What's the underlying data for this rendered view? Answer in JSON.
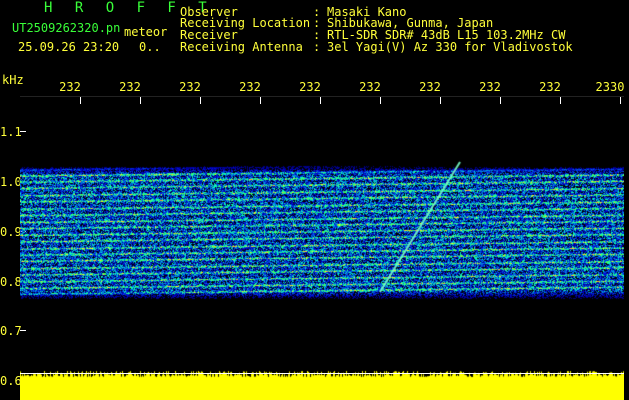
{
  "header": {
    "station": "H R O F F T",
    "filename": "UT2509262320.pn",
    "meteor_word": "meteor",
    "local_time": "25.09.26 23:20",
    "count": "0..",
    "fields": [
      {
        "label": "Observer",
        "sep": ":",
        "value": "Masaki Kano"
      },
      {
        "label": "Receiving Location",
        "sep": ":",
        "value": "Shibukawa, Gunma, Japan"
      },
      {
        "label": "Receiver",
        "sep": ":",
        "value": "RTL-SDR SDR# 43dB L15 103.2MHz CW"
      },
      {
        "label": "Receiving Antenna",
        "sep": ":",
        "value": "3el Yagi(V) Az 330 for Vladivostok"
      }
    ]
  },
  "axes": {
    "y_unit": "kHz",
    "y_ticks": [
      "1.1",
      "1.0",
      "0.9",
      "0.8",
      "0.7",
      "0.6"
    ],
    "x_ticks": [
      "232",
      "232",
      "232",
      "232",
      "232",
      "232",
      "232",
      "232",
      "232",
      "2330"
    ]
  },
  "colors": {
    "text_primary": "#39ff39",
    "text_secondary": "#ffff3a",
    "background": "#000000",
    "spectrum_low": "#0b0b6a",
    "spectrum_mid": "#00ff9a",
    "spectrum_high": "#ff3030",
    "audio_trace": "#ffff00"
  }
}
